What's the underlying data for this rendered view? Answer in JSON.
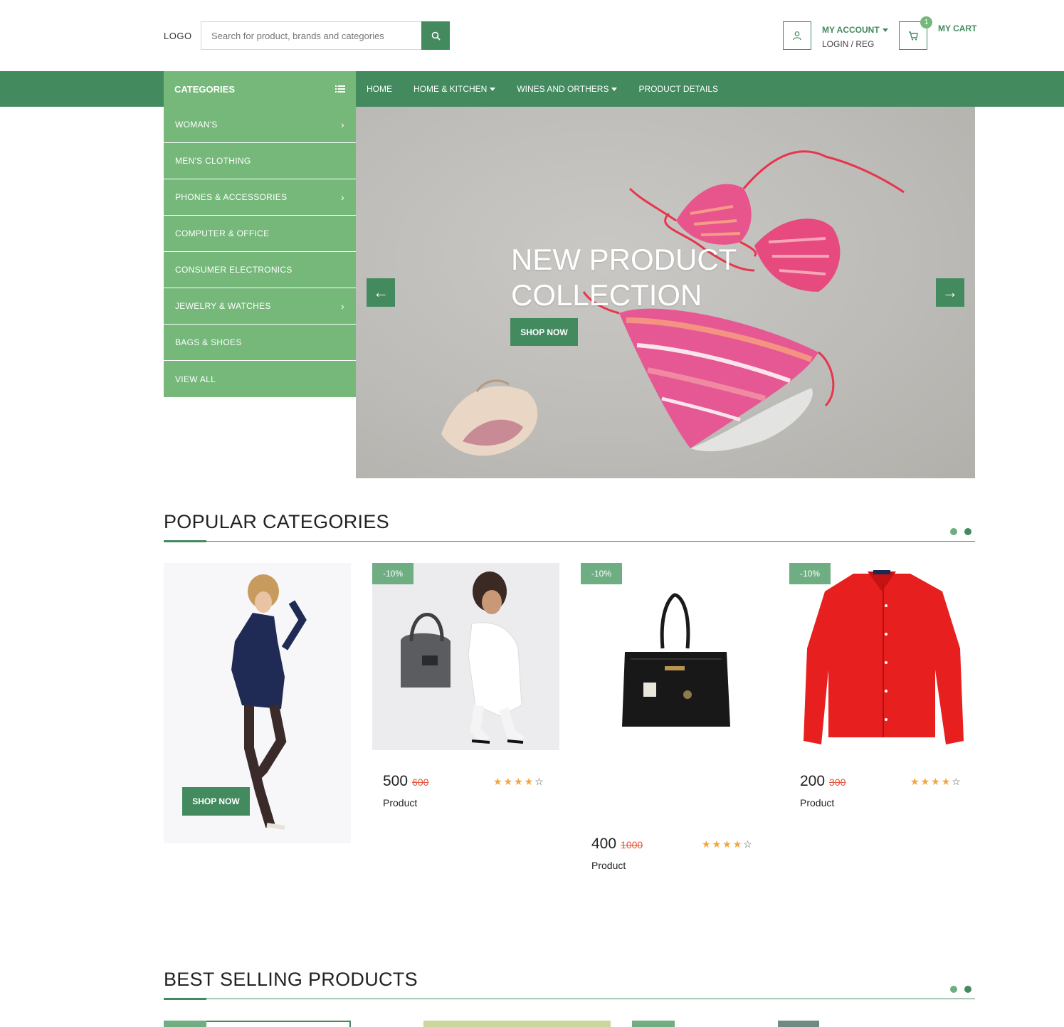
{
  "header": {
    "logo": "LOGO",
    "search_placeholder": "Search for product, brands and categories",
    "account_title": "MY ACCOUNT",
    "account_sub": "LOGIN / REG",
    "cart_count": "1",
    "cart_label": "MY CART"
  },
  "nav": {
    "categories_label": "CATEGORIES",
    "links": [
      "HOME",
      "HOME & KITCHEN",
      "WINES AND ORTHERS",
      "PRODUCT DETAILS"
    ]
  },
  "categories": [
    {
      "label": "WOMAN'S",
      "has_sub": true
    },
    {
      "label": "MEN'S CLOTHING",
      "has_sub": false
    },
    {
      "label": "PHONES & ACCESSORIES",
      "has_sub": true
    },
    {
      "label": "COMPUTER & OFFICE",
      "has_sub": false
    },
    {
      "label": "CONSUMER ELECTRONICS",
      "has_sub": false
    },
    {
      "label": "JEWELRY & WATCHES",
      "has_sub": true
    },
    {
      "label": "BAGS & SHOES",
      "has_sub": false
    },
    {
      "label": "VIEW ALL",
      "has_sub": false
    }
  ],
  "hero": {
    "title_line1": "NEW PRODUCT",
    "title_line2": "COLLECTION",
    "button": "SHOP NOW",
    "prev_arrow": "←",
    "next_arrow": "→"
  },
  "popular": {
    "title": "POPULAR CATEGORIES",
    "promo_button": "SHOP NOW",
    "products": [
      {
        "badge": "-10%",
        "price": "500",
        "old_price": "600",
        "name": "Product",
        "rating": 4
      },
      {
        "badge": "-10%",
        "price": "400",
        "old_price": "1000",
        "name": "Product",
        "rating": 4
      },
      {
        "badge": "-10%",
        "price": "200",
        "old_price": "300",
        "name": "Product",
        "rating": 4
      }
    ]
  },
  "best": {
    "title": "BEST SELLING PRODUCTS"
  },
  "colors": {
    "primary": "#438a5e",
    "light": "#75b87a",
    "sale": "#e5553c",
    "star": "#f3a43b"
  }
}
